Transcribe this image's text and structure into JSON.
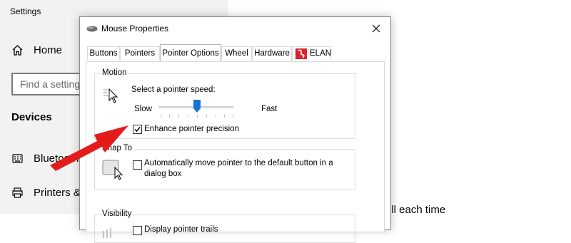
{
  "settings": {
    "title": "Settings",
    "home_label": "Home",
    "search_placeholder": "Find a setting",
    "section_heading": "Devices",
    "nav_items": [
      "Bluetooth & other devices",
      "Printers & scanners"
    ],
    "bottom_text": "oll each time"
  },
  "dialog": {
    "title": "Mouse Properties",
    "tabs": [
      "Buttons",
      "Pointers",
      "Pointer Options",
      "Wheel",
      "Hardware",
      "ELAN"
    ],
    "active_tab": "Pointer Options",
    "motion": {
      "group_label": "Motion",
      "speed_label": "Select a pointer speed:",
      "slow_label": "Slow",
      "fast_label": "Fast",
      "speed_value": 0.45,
      "precision_label": "Enhance pointer precision",
      "precision_checked": true
    },
    "snap_to": {
      "group_label": "Snap To",
      "checkbox_label_line1": "Automatically move pointer to the default button in a",
      "checkbox_label_line2": "dialog box",
      "checked": false
    },
    "visibility": {
      "group_label": "Visibility",
      "trails_label": "Display pointer trails"
    }
  },
  "colors": {
    "annotation_arrow": "#e31b1b",
    "slider_thumb": "#1a73d1",
    "elan_logo": "#d6242a"
  }
}
